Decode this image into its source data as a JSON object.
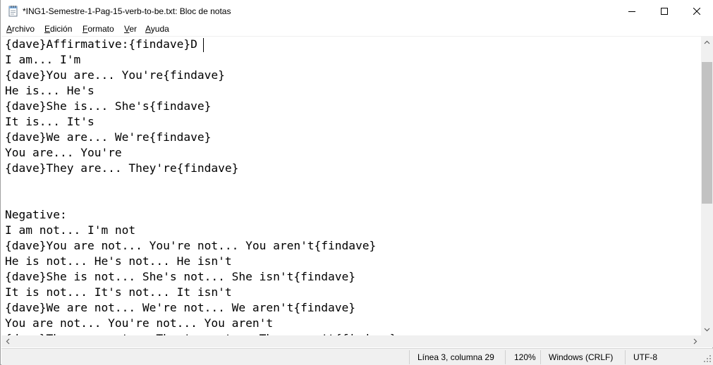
{
  "window": {
    "title": "*ING1-Semestre-1-Pag-15-verb-to-be.txt: Bloc de notas",
    "app_icon": "notepad-icon",
    "controls": {
      "minimize_icon": "minimize-icon",
      "maximize_icon": "maximize-icon",
      "close_icon": "close-icon"
    }
  },
  "menu": {
    "items": [
      {
        "accel": "A",
        "rest": "rchivo"
      },
      {
        "accel": "E",
        "rest": "dición"
      },
      {
        "accel": "F",
        "rest": "ormato"
      },
      {
        "accel": "V",
        "rest": "er"
      },
      {
        "accel": "A",
        "rest": "yuda"
      }
    ]
  },
  "editor": {
    "lines": [
      "{dave}Affirmative:{findave}D",
      "I am... I'm",
      "{dave}You are... You're{findave}",
      "He is... He's",
      "{dave}She is... She's{findave}",
      "It is... It's",
      "{dave}We are... We're{findave}",
      "You are... You're",
      "{dave}They are... They're{findave}",
      "",
      "",
      "Negative:",
      "I am not... I'm not",
      "{dave}You are not... You're not... You aren't{findave}",
      "He is not... He's not... He isn't",
      "{dave}She is not... She's not... She isn't{findave}",
      "It is not... It's not... It isn't",
      "{dave}We are not... We're not... We aren't{findave}",
      "You are not... You're not... You aren't",
      "{dave}They are not... They're not... They aren't{findave}"
    ]
  },
  "statusbar": {
    "position": "Línea 3, columna 29",
    "zoom": "120%",
    "line_ending": "Windows (CRLF)",
    "encoding": "UTF-8"
  }
}
